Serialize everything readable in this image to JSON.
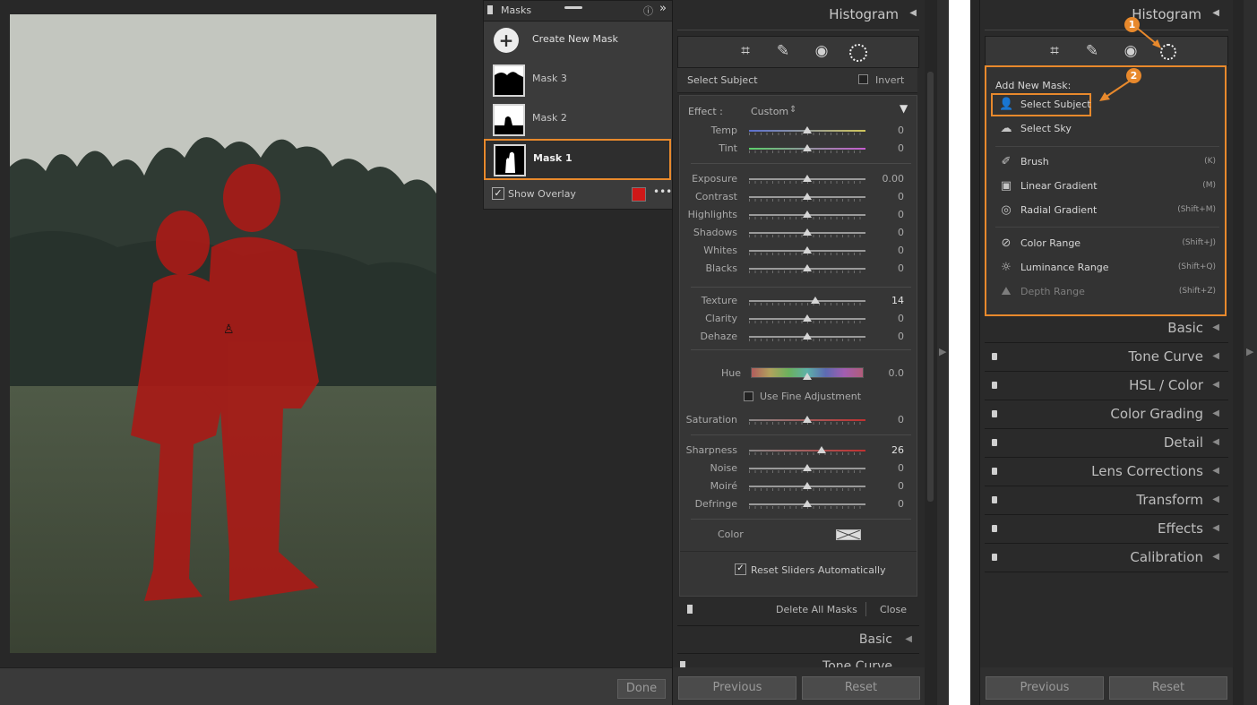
{
  "masks_panel": {
    "title": "Masks",
    "create_label": "Create New Mask",
    "masks": [
      {
        "label": "Mask 3"
      },
      {
        "label": "Mask 2"
      },
      {
        "label": "Mask 1"
      }
    ],
    "show_overlay_label": "Show Overlay",
    "overlay_color": "#d01818"
  },
  "left_develop": {
    "histogram_title": "Histogram",
    "select_subject": "Select Subject",
    "invert_label": "Invert",
    "effect_label": "Effect :",
    "effect_value": "Custom",
    "sliders_group1": [
      {
        "label": "Temp",
        "value": "0",
        "pos": 0.5
      },
      {
        "label": "Tint",
        "value": "0",
        "pos": 0.5
      }
    ],
    "sliders_group2": [
      {
        "label": "Exposure",
        "value": "0.00",
        "pos": 0.5
      },
      {
        "label": "Contrast",
        "value": "0",
        "pos": 0.5
      },
      {
        "label": "Highlights",
        "value": "0",
        "pos": 0.5
      },
      {
        "label": "Shadows",
        "value": "0",
        "pos": 0.5
      },
      {
        "label": "Whites",
        "value": "0",
        "pos": 0.5
      },
      {
        "label": "Blacks",
        "value": "0",
        "pos": 0.5
      }
    ],
    "sliders_group3": [
      {
        "label": "Texture",
        "value": "14",
        "pos": 0.57
      },
      {
        "label": "Clarity",
        "value": "0",
        "pos": 0.5
      },
      {
        "label": "Dehaze",
        "value": "0",
        "pos": 0.5
      }
    ],
    "hue_label": "Hue",
    "hue_value": "0.0",
    "fine_adjust_label": "Use Fine Adjustment",
    "saturation_label": "Saturation",
    "saturation_value": "0",
    "sliders_group4": [
      {
        "label": "Sharpness",
        "value": "26",
        "pos": 0.62
      },
      {
        "label": "Noise",
        "value": "0",
        "pos": 0.5
      },
      {
        "label": "Moiré",
        "value": "0",
        "pos": 0.5
      },
      {
        "label": "Defringe",
        "value": "0",
        "pos": 0.5
      }
    ],
    "color_label": "Color",
    "reset_sliders_label": "Reset Sliders Automatically",
    "delete_all_label": "Delete All Masks",
    "close_label": "Close",
    "basic_label": "Basic",
    "tone_curve_label": "Tone Curve",
    "previous_label": "Previous",
    "reset_label": "Reset"
  },
  "done_label": "Done",
  "right_develop": {
    "histogram_title": "Histogram",
    "add_new_mask_label": "Add New Mask:",
    "menu": [
      {
        "icon": "person-icon",
        "label": "Select Subject",
        "shortcut": ""
      },
      {
        "icon": "sky-icon",
        "label": "Select Sky",
        "shortcut": ""
      },
      {
        "icon": "brush-icon",
        "label": "Brush",
        "shortcut": "(K)"
      },
      {
        "icon": "linear-gradient-icon",
        "label": "Linear Gradient",
        "shortcut": "(M)"
      },
      {
        "icon": "radial-gradient-icon",
        "label": "Radial Gradient",
        "shortcut": "(Shift+M)"
      },
      {
        "icon": "color-range-icon",
        "label": "Color Range",
        "shortcut": "(Shift+J)"
      },
      {
        "icon": "luminance-range-icon",
        "label": "Luminance Range",
        "shortcut": "(Shift+Q)"
      },
      {
        "icon": "depth-range-icon",
        "label": "Depth Range",
        "shortcut": "(Shift+Z)"
      }
    ],
    "callout_1": "1",
    "callout_2": "2",
    "sections": [
      {
        "label": "Basic"
      },
      {
        "label": "Tone Curve"
      },
      {
        "label": "HSL / Color"
      },
      {
        "label": "Color Grading"
      },
      {
        "label": "Detail"
      },
      {
        "label": "Lens Corrections"
      },
      {
        "label": "Transform"
      },
      {
        "label": "Effects"
      },
      {
        "label": "Calibration"
      }
    ],
    "previous_label": "Previous",
    "reset_label": "Reset"
  }
}
